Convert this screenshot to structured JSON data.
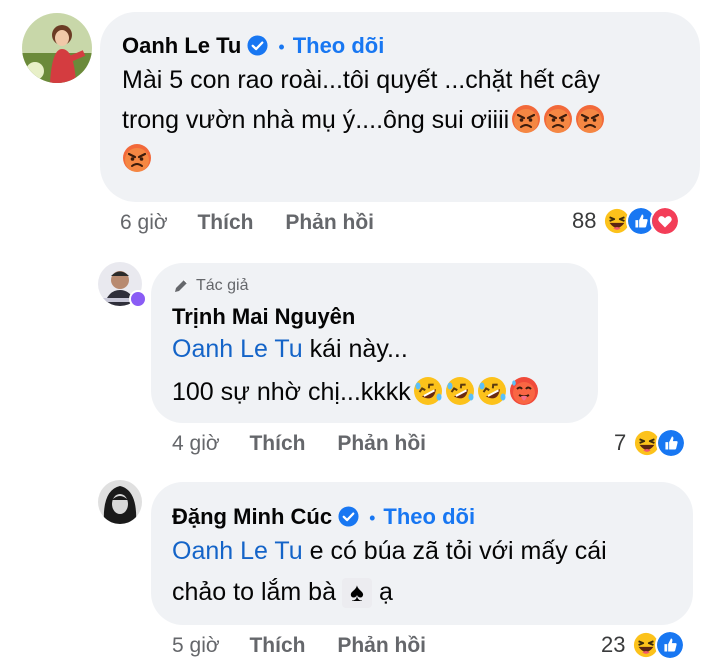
{
  "comments": [
    {
      "author": "Oanh Le Tu",
      "verified": true,
      "follow_label": "Theo dõi",
      "text_line1": "Mài 5 con rao roài...tôi quyết ...chặt hết cây",
      "text_line2": "trong vườn nhà mụ ý....ông sui ơiiii",
      "emojis": [
        "pouting-face",
        "pouting-face",
        "pouting-face",
        "pouting-face"
      ],
      "time": "6 giờ",
      "like_label": "Thích",
      "reply_label": "Phản hồi",
      "reaction_count": "88",
      "reactions": [
        "haha",
        "like",
        "love"
      ]
    },
    {
      "author_tag": "Tác giả",
      "author": "Trịnh Mai Nguyên",
      "mention": "Oanh Le Tu",
      "text_line1": " kái này...",
      "text_line2": "100 sự nhờ chị...kkkk",
      "emojis": [
        "rofl",
        "rofl",
        "rofl",
        "hot-face"
      ],
      "time": "4 giờ",
      "like_label": "Thích",
      "reply_label": "Phản hồi",
      "reaction_count": "7",
      "reactions": [
        "haha",
        "like"
      ]
    },
    {
      "author": "Đặng Minh Cúc",
      "verified": true,
      "follow_label": "Theo dõi",
      "mention": "Oanh Le Tu",
      "text_line1": " e có búa zã tỏi với mấy cái",
      "text_line2": "chảo to lắm bà",
      "text_line2_end": " ạ",
      "time": "5 giờ",
      "like_label": "Thích",
      "reply_label": "Phản hồi",
      "reaction_count": "23",
      "reactions": [
        "haha",
        "like"
      ]
    }
  ]
}
